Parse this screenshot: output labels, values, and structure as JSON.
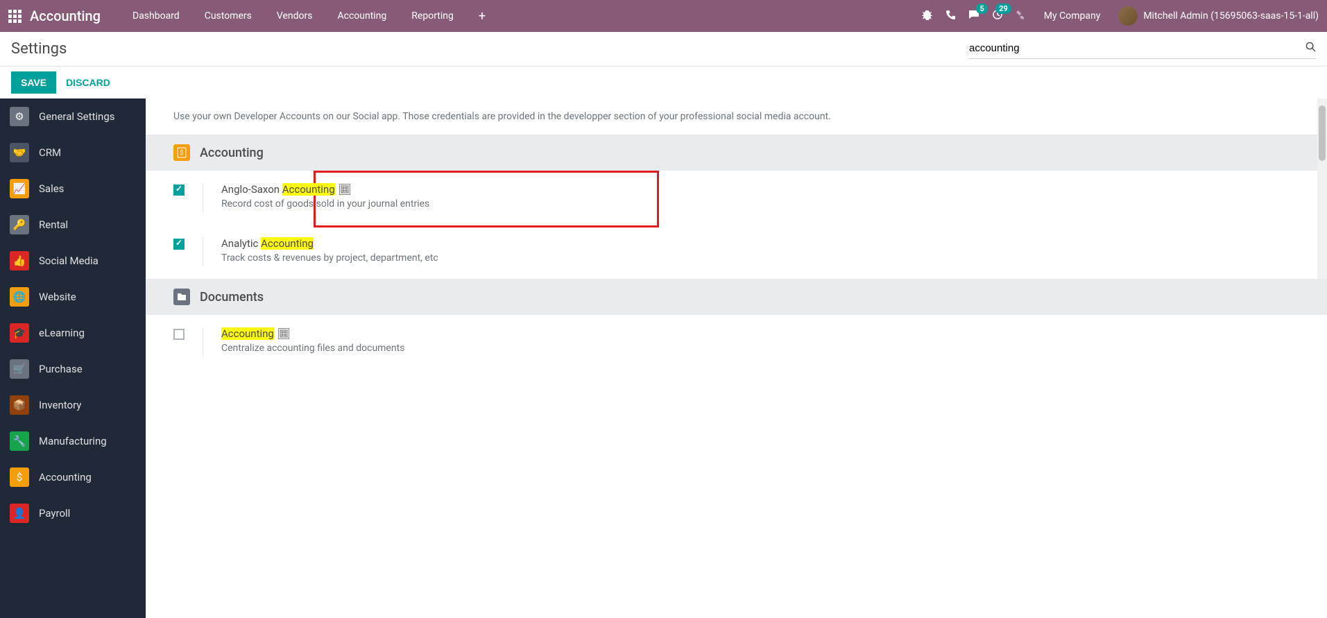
{
  "navbar": {
    "app_name": "Accounting",
    "items": [
      "Dashboard",
      "Customers",
      "Vendors",
      "Accounting",
      "Reporting"
    ],
    "messages_count": "5",
    "activities_count": "29",
    "company": "My Company",
    "user": "Mitchell Admin (15695063-saas-15-1-all)"
  },
  "subheader": {
    "title": "Settings",
    "search_value": "accounting"
  },
  "actions": {
    "save": "SAVE",
    "discard": "DISCARD"
  },
  "sidebar": {
    "items": [
      {
        "label": "General Settings"
      },
      {
        "label": "CRM"
      },
      {
        "label": "Sales"
      },
      {
        "label": "Rental"
      },
      {
        "label": "Social Media"
      },
      {
        "label": "Website"
      },
      {
        "label": "eLearning"
      },
      {
        "label": "Purchase"
      },
      {
        "label": "Inventory"
      },
      {
        "label": "Manufacturing"
      },
      {
        "label": "Accounting"
      },
      {
        "label": "Payroll"
      }
    ]
  },
  "main": {
    "info_text": "Use your own Developer Accounts on our Social app. Those credentials are provided in the developper section of your professional social media account.",
    "sections": [
      {
        "title": "Accounting"
      },
      {
        "title": "Documents"
      }
    ],
    "settings": [
      {
        "label_pre": "Anglo-Saxon ",
        "label_hl": "Accounting",
        "has_company_icon": true,
        "desc": "Record cost of goods sold in your journal entries"
      },
      {
        "label_pre": "Analytic ",
        "label_hl": "Accounting",
        "has_company_icon": false,
        "desc": "Track costs & revenues by project, department, etc"
      },
      {
        "label_pre": "",
        "label_hl": "Accounting",
        "has_company_icon": true,
        "desc": "Centralize accounting files and documents"
      }
    ]
  }
}
